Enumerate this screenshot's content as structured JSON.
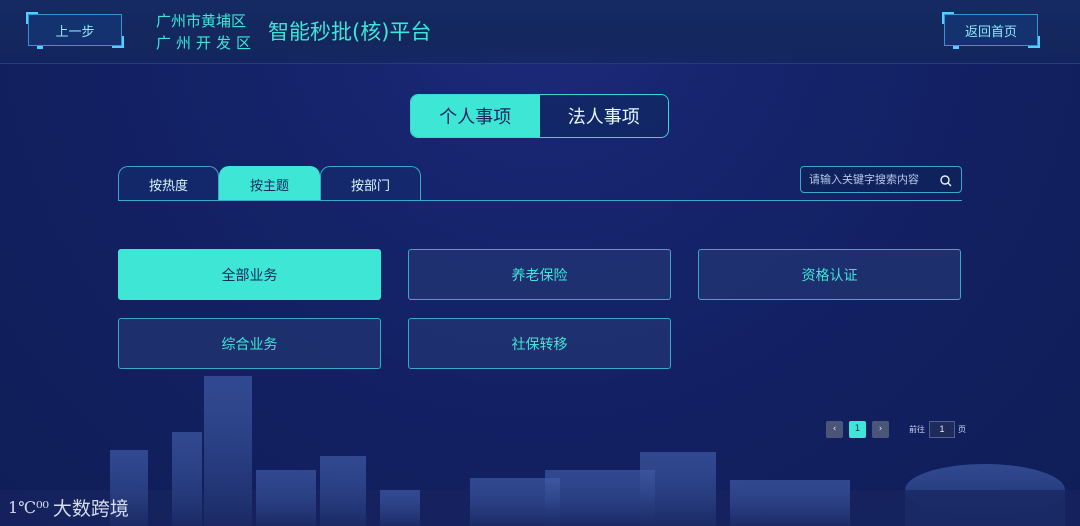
{
  "header": {
    "back_label": "上一步",
    "home_label": "返回首页",
    "district_line1": "广州市黄埔区",
    "district_line2": "广州开发区",
    "title": "智能秒批(核)平台"
  },
  "main_tabs": [
    {
      "label": "个人事项",
      "active": true
    },
    {
      "label": "法人事项",
      "active": false
    }
  ],
  "sub_tabs": [
    {
      "label": "按热度",
      "active": false
    },
    {
      "label": "按主题",
      "active": true
    },
    {
      "label": "按部门",
      "active": false
    }
  ],
  "search": {
    "placeholder": "请输入关键字搜索内容"
  },
  "cards": [
    {
      "label": "全部业务",
      "active": true
    },
    {
      "label": "养老保险",
      "active": false
    },
    {
      "label": "资格认证",
      "active": false
    },
    {
      "label": "综合业务",
      "active": false
    },
    {
      "label": "社保转移",
      "active": false
    }
  ],
  "pagination": {
    "prev": "‹",
    "current": "1",
    "next": "›",
    "goto_label": "前往",
    "goto_value": "1",
    "unit": "页"
  },
  "watermark": {
    "logo": "1℃⁰⁰",
    "text": "大数跨境"
  },
  "colors": {
    "accent": "#3ee6d6",
    "background": "#142268",
    "border": "#3aa9c9"
  }
}
